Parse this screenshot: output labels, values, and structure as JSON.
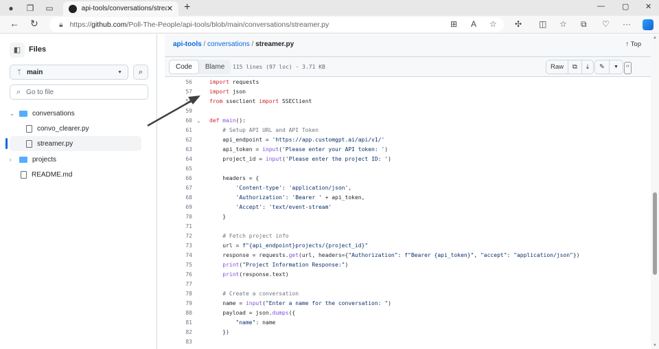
{
  "browser": {
    "tab_title": "api-tools/conversations/streamer.py",
    "tab_close": "✕",
    "new_tab": "+",
    "url_prefix": "https://",
    "url_host": "github.com",
    "url_path": "/Poll-The-People/api-tools/blob/main/conversations/streamer.py",
    "more": "···"
  },
  "sidebar": {
    "title": "Files",
    "branch": "main",
    "search_placeholder": "Go to file",
    "tree": [
      {
        "label": "conversations",
        "type": "folder",
        "expanded": true
      },
      {
        "label": "convo_clearer.py",
        "type": "file"
      },
      {
        "label": "streamer.py",
        "type": "file",
        "selected": true
      },
      {
        "label": "projects",
        "type": "folder",
        "expanded": false
      },
      {
        "label": "README.md",
        "type": "file"
      }
    ]
  },
  "main": {
    "breadcrumb": {
      "repo": "api-tools",
      "folder": "conversations",
      "file": "streamer.py",
      "sep": "/"
    },
    "top_label": "Top",
    "tabs": {
      "code": "Code",
      "blame": "Blame"
    },
    "file_meta": "115 lines (97 loc) · 3.71 KB",
    "raw_label": "Raw",
    "code_lines": [
      {
        "n": "56",
        "t": [
          [
            "k",
            "import"
          ],
          [
            "",
            "requests"
          ]
        ]
      },
      {
        "n": "57",
        "t": [
          [
            "k",
            "import"
          ],
          [
            "",
            "json"
          ]
        ]
      },
      {
        "n": "58",
        "t": [
          [
            "k",
            "from"
          ],
          [
            "",
            " sseclient "
          ],
          [
            "k",
            "import"
          ],
          [
            "",
            " SSEClient"
          ]
        ]
      },
      {
        "n": "59",
        "t": []
      },
      {
        "n": "60",
        "fold": true,
        "t": [
          [
            "k",
            "def"
          ],
          [
            "",
            " "
          ],
          [
            "f",
            "main"
          ],
          [
            "",
            "():"
          ]
        ]
      },
      {
        "n": "61",
        "t": [
          [
            "c",
            "    # Setup API URL and API Token"
          ]
        ]
      },
      {
        "n": "62",
        "t": [
          [
            "",
            "    api_endpoint = "
          ],
          [
            "s",
            "'https://app.customgpt.ai/api/v1/'"
          ]
        ]
      },
      {
        "n": "63",
        "t": [
          [
            "",
            "    api_token = "
          ],
          [
            "f",
            "input"
          ],
          [
            "",
            "("
          ],
          [
            "s",
            "'Please enter your API token: '"
          ],
          [
            "",
            ")"
          ]
        ]
      },
      {
        "n": "64",
        "t": [
          [
            "",
            "    project_id = "
          ],
          [
            "f",
            "input"
          ],
          [
            "",
            "("
          ],
          [
            "s",
            "'Please enter the project ID: '"
          ],
          [
            "",
            ")"
          ]
        ]
      },
      {
        "n": "65",
        "t": []
      },
      {
        "n": "66",
        "t": [
          [
            "",
            "    headers = {"
          ]
        ]
      },
      {
        "n": "67",
        "t": [
          [
            "s",
            "        'Content-type'"
          ],
          [
            "",
            ": "
          ],
          [
            "s",
            "'application/json'"
          ],
          [
            "",
            ","
          ]
        ]
      },
      {
        "n": "68",
        "t": [
          [
            "s",
            "        'Authorization'"
          ],
          [
            "",
            ": "
          ],
          [
            "s",
            "'Bearer '"
          ],
          [
            "",
            " + api_token,"
          ]
        ]
      },
      {
        "n": "69",
        "t": [
          [
            "s",
            "        'Accept'"
          ],
          [
            "",
            ": "
          ],
          [
            "s",
            "'text/event-stream'"
          ]
        ]
      },
      {
        "n": "70",
        "t": [
          [
            "",
            "    }"
          ]
        ]
      },
      {
        "n": "71",
        "t": []
      },
      {
        "n": "72",
        "t": [
          [
            "c",
            "    # Fetch project info"
          ]
        ]
      },
      {
        "n": "73",
        "t": [
          [
            "",
            "    url = "
          ],
          [
            "s",
            "f\"{api_endpoint}projects/{project_id}\""
          ]
        ]
      },
      {
        "n": "74",
        "t": [
          [
            "",
            "    response = requests."
          ],
          [
            "f",
            "get"
          ],
          [
            "",
            "(url, headers={"
          ],
          [
            "s",
            "\"Authorization\""
          ],
          [
            "",
            ": "
          ],
          [
            "s",
            "f\"Bearer {api_token}\""
          ],
          [
            "",
            ", "
          ],
          [
            "s",
            "\"accept\""
          ],
          [
            "",
            ": "
          ],
          [
            "s",
            "\"application/json\""
          ],
          [
            "",
            "})"
          ]
        ]
      },
      {
        "n": "75",
        "t": [
          [
            "f",
            "    print"
          ],
          [
            "",
            "("
          ],
          [
            "s",
            "\"Project Information Response:\""
          ],
          [
            "",
            ")"
          ]
        ]
      },
      {
        "n": "76",
        "t": [
          [
            "f",
            "    print"
          ],
          [
            "",
            "(response.text)"
          ]
        ]
      },
      {
        "n": "77",
        "t": []
      },
      {
        "n": "78",
        "t": [
          [
            "c",
            "    # Create a conversation"
          ]
        ]
      },
      {
        "n": "79",
        "t": [
          [
            "",
            "    name = "
          ],
          [
            "f",
            "input"
          ],
          [
            "",
            "("
          ],
          [
            "s",
            "\"Enter a name for the conversation: \""
          ],
          [
            "",
            ")"
          ]
        ]
      },
      {
        "n": "80",
        "t": [
          [
            "",
            "    payload = json."
          ],
          [
            "f",
            "dumps"
          ],
          [
            "",
            "({"
          ]
        ]
      },
      {
        "n": "81",
        "t": [
          [
            "s",
            "        \"name\""
          ],
          [
            "",
            ": name"
          ]
        ]
      },
      {
        "n": "82",
        "t": [
          [
            "",
            "    })"
          ]
        ]
      },
      {
        "n": "83",
        "t": []
      }
    ]
  },
  "colors": {
    "accent": "#0969da",
    "keyword": "#cf222e",
    "function": "#8250df",
    "string": "#0a3069",
    "comment": "#6e7781",
    "folder": "#54aeff",
    "annotation_arrow": "#404040"
  }
}
